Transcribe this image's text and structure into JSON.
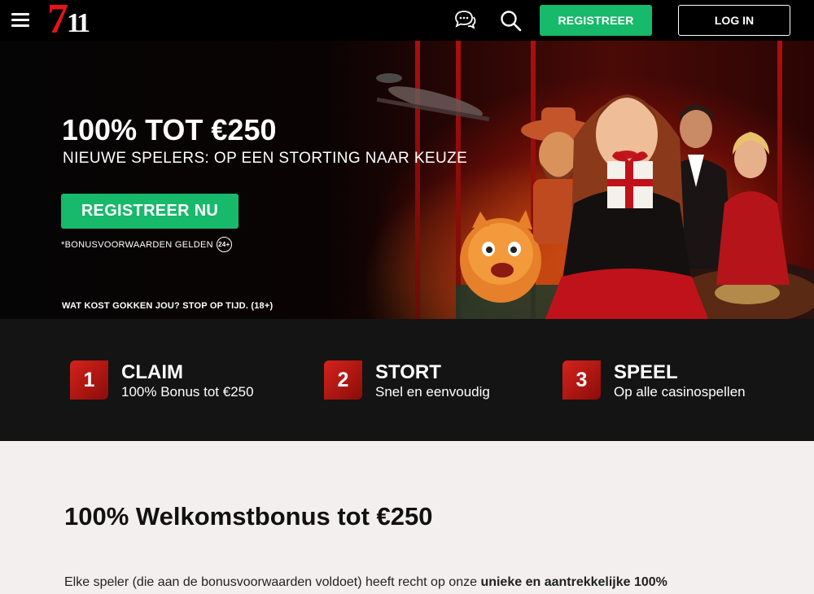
{
  "header": {
    "logo_seven": "7",
    "logo_eleven": "11",
    "register_label": "REGISTREER",
    "login_label": "LOG IN"
  },
  "hero": {
    "title": "100% TOT €250",
    "subtitle": "NIEUWE SPELERS: OP EEN STORTING NAAR KEUZE",
    "cta_label": "REGISTREER NU",
    "terms": "*BONUSVOORWAARDEN GELDEN",
    "age_badge": "24+",
    "warning": "WAT KOST GOKKEN JOU?  STOP OP TIJD. (18+)"
  },
  "steps": [
    {
      "number": "1",
      "title": "CLAIM",
      "description": "100% Bonus tot €250"
    },
    {
      "number": "2",
      "title": "STORT",
      "description": "Snel en eenvoudig"
    },
    {
      "number": "3",
      "title": "SPEEL",
      "description": "Op alle casinospellen"
    }
  ],
  "content": {
    "title": "100% Welkomstbonus tot €250",
    "paragraph_start": "Elke speler (die aan de bonusvoorwaarden voldoet) heeft recht op onze ",
    "paragraph_bold": "unieke en aantrekkelijke 100%"
  },
  "colors": {
    "brand_red": "#e3141b",
    "cta_green": "#17b96a",
    "header_bg": "#000000",
    "steps_bg": "#141414",
    "page_bg": "#f3efee"
  }
}
